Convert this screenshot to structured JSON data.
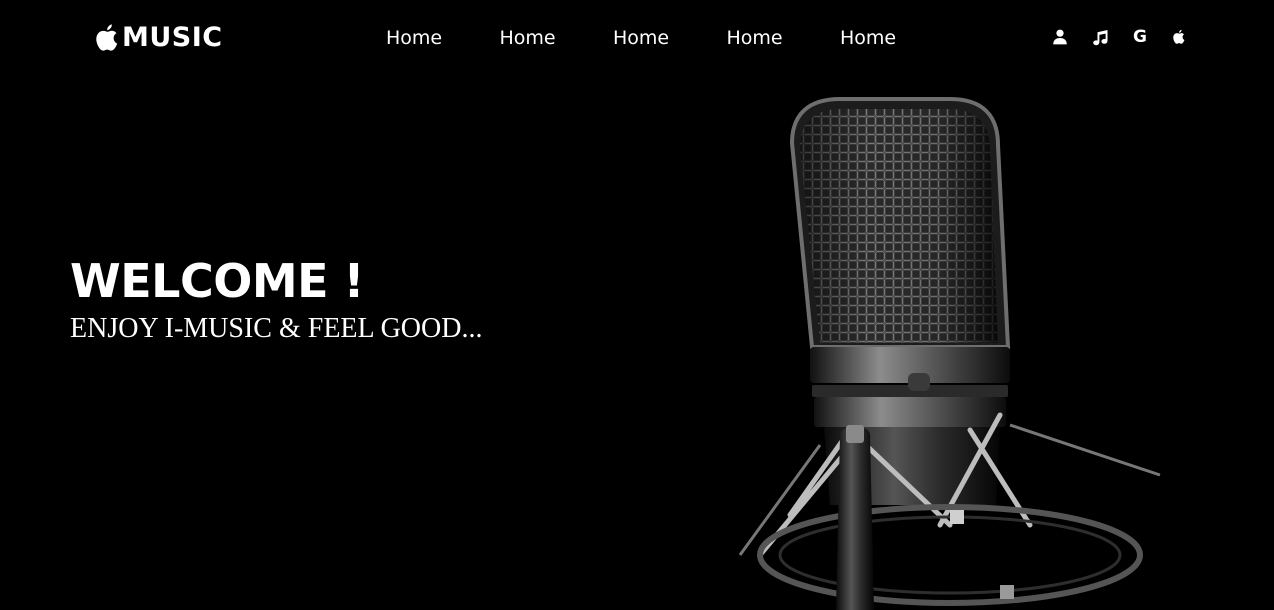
{
  "header": {
    "logo": {
      "icon": "apple-icon",
      "text": "MUSIC"
    },
    "nav": [
      {
        "label": "Home"
      },
      {
        "label": "Home"
      },
      {
        "label": "Home"
      },
      {
        "label": "Home"
      },
      {
        "label": "Home"
      }
    ],
    "icons": [
      {
        "icon": "user-icon"
      },
      {
        "icon": "music-note-icon"
      },
      {
        "icon": "google-icon",
        "glyph": "G"
      },
      {
        "icon": "apple-icon"
      }
    ]
  },
  "hero": {
    "title": "WELCOME !",
    "subtitle": "ENJOY I-MUSIC & FEEL GOOD...",
    "image": "microphone-image"
  },
  "colors": {
    "background": "#000000",
    "text": "#ffffff"
  }
}
